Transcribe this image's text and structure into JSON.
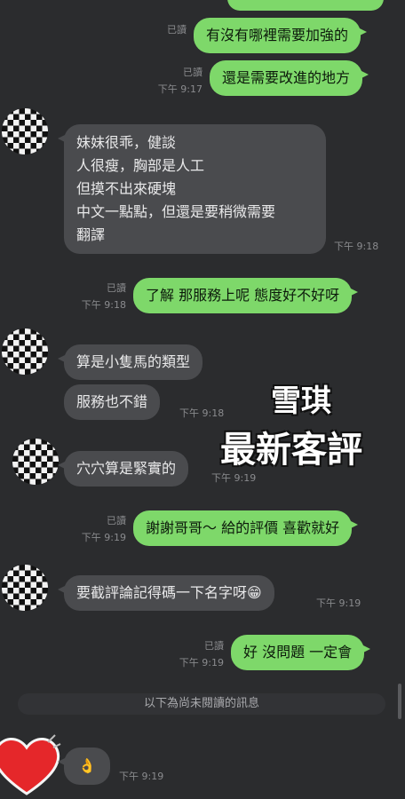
{
  "messages": [
    {
      "id": "m0",
      "dir": "out",
      "text": "",
      "read": "",
      "time": ""
    },
    {
      "id": "m1",
      "dir": "out",
      "text": "有沒有哪裡需要加強的",
      "read": "已讀",
      "time": ""
    },
    {
      "id": "m2",
      "dir": "out",
      "text": "還是需要改進的地方",
      "read": "已讀",
      "time": "下午 9:17"
    },
    {
      "id": "m3",
      "dir": "in",
      "lines": [
        "妹妹很乖，健談",
        "人很瘦，胸部是人工",
        "但摸不出來硬塊",
        "中文一點點，但還是要稍微需要",
        "翻譯"
      ],
      "time": "下午 9:18"
    },
    {
      "id": "m4",
      "dir": "out",
      "text": "了解 那服務上呢 態度好不好呀",
      "read": "已讀",
      "time": "下午 9:18"
    },
    {
      "id": "m5",
      "dir": "in",
      "text": "算是小隻馬的類型",
      "time": ""
    },
    {
      "id": "m6",
      "dir": "in",
      "text": "服務也不錯",
      "time": "下午 9:18"
    },
    {
      "id": "m7",
      "dir": "in",
      "text": "穴穴算是緊實的",
      "time": "下午 9:19"
    },
    {
      "id": "m8",
      "dir": "out",
      "text": "謝謝哥哥～ 給的評價 喜歡就好",
      "read": "已讀",
      "time": "下午 9:19"
    },
    {
      "id": "m9",
      "dir": "in",
      "text": "要截評論記得碼一下名字呀😁",
      "time": "下午 9:19"
    },
    {
      "id": "m10",
      "dir": "out",
      "text": "好 沒問題 一定會",
      "read": "已讀",
      "time": "下午 9:19"
    },
    {
      "id": "m11",
      "dir": "in",
      "text": "👌",
      "time": "下午 9:19"
    }
  ],
  "unread_divider": "以下為尚未閱讀的訊息",
  "overlay": {
    "line1": "雪琪",
    "line2": "最新客評"
  },
  "colors": {
    "bg": "#2b2c2e",
    "outgoing": "#7ed86a",
    "incoming": "#4a4b4e",
    "heart": "#e5272a"
  }
}
